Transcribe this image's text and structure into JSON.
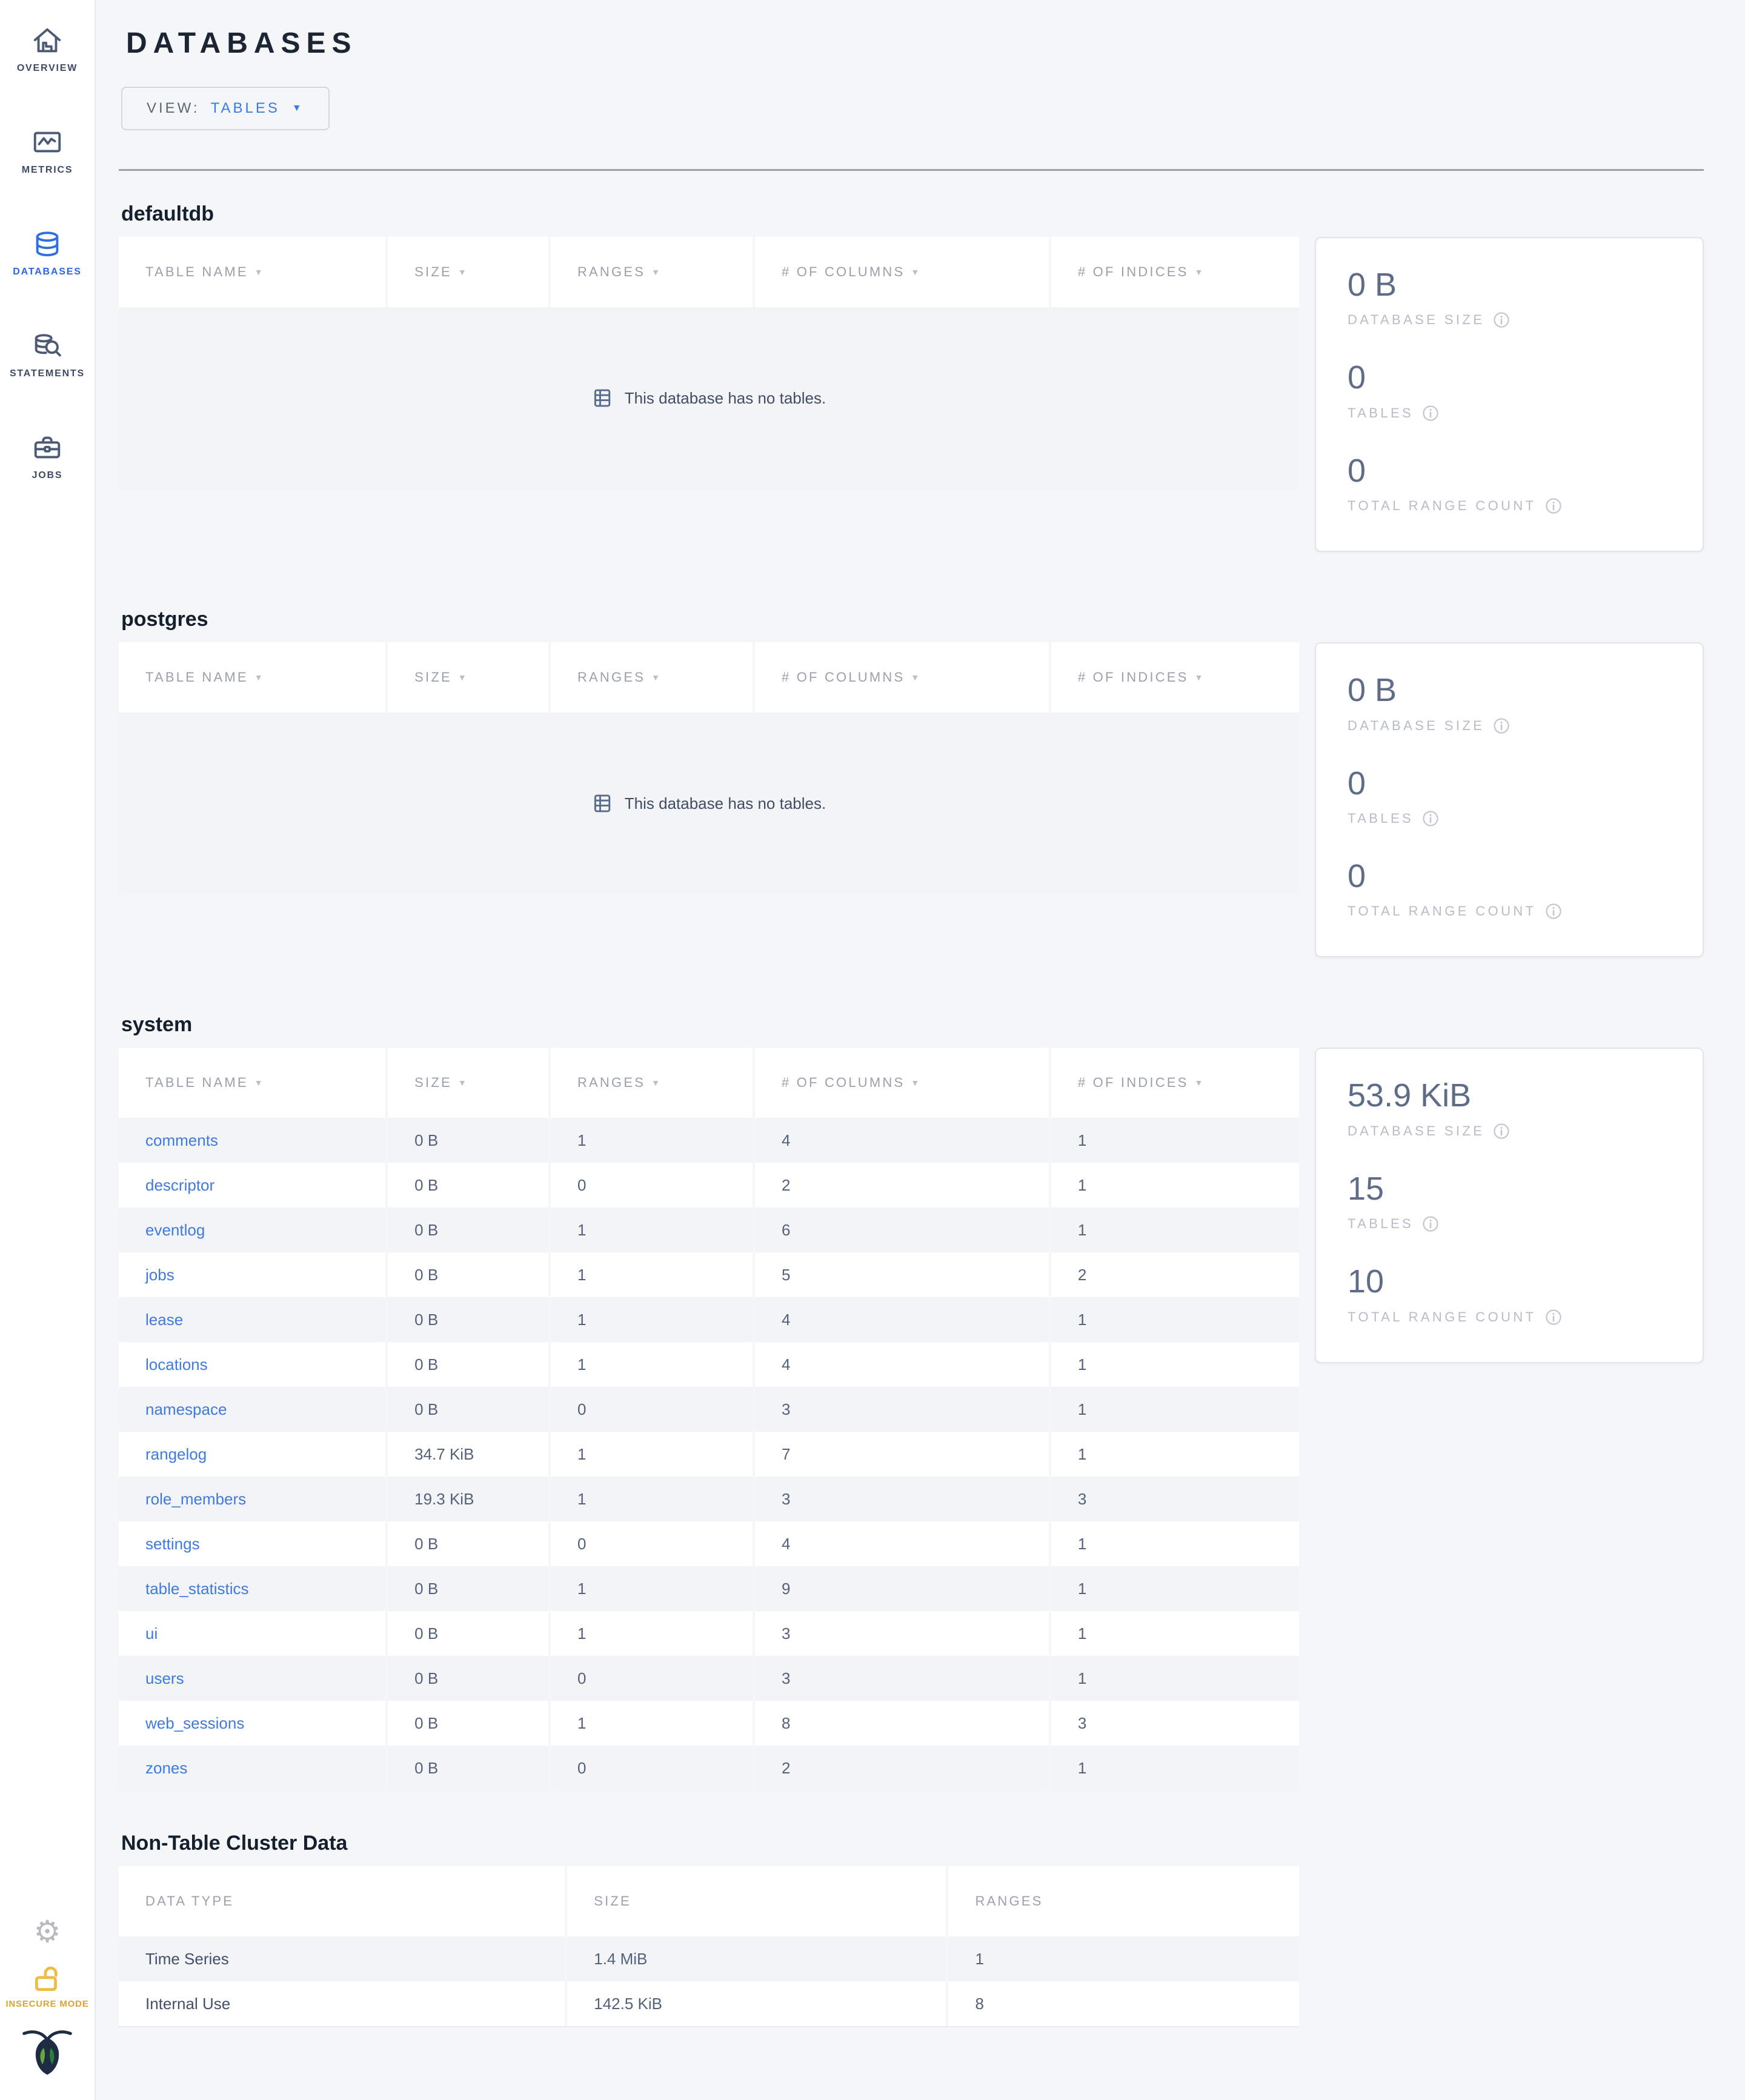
{
  "sidebar": {
    "items": [
      {
        "label": "OVERVIEW",
        "icon": "home-icon",
        "active": false
      },
      {
        "label": "METRICS",
        "icon": "metrics-icon",
        "active": false
      },
      {
        "label": "DATABASES",
        "icon": "database-icon",
        "active": true
      },
      {
        "label": "STATEMENTS",
        "icon": "statements-icon",
        "active": false
      },
      {
        "label": "JOBS",
        "icon": "jobs-icon",
        "active": false
      }
    ],
    "insecure_label": "INSECURE MODE"
  },
  "header": {
    "title": "DATABASES",
    "view_label": "VIEW:",
    "view_value": "TABLES"
  },
  "table_headers": {
    "name": "TABLE NAME",
    "size": "SIZE",
    "ranges": "RANGES",
    "columns": "# OF COLUMNS",
    "indices": "# OF INDICES"
  },
  "empty_message": "This database has no tables.",
  "stat_labels": {
    "size": "DATABASE SIZE",
    "tables": "TABLES",
    "range_count": "TOTAL RANGE COUNT"
  },
  "databases": [
    {
      "name": "defaultdb",
      "stats": {
        "size": "0 B",
        "tables": "0",
        "range_count": "0"
      },
      "tables": []
    },
    {
      "name": "postgres",
      "stats": {
        "size": "0 B",
        "tables": "0",
        "range_count": "0"
      },
      "tables": []
    },
    {
      "name": "system",
      "stats": {
        "size": "53.9 KiB",
        "tables": "15",
        "range_count": "10"
      },
      "tables": [
        {
          "name": "comments",
          "size": "0 B",
          "ranges": "1",
          "columns": "4",
          "indices": "1"
        },
        {
          "name": "descriptor",
          "size": "0 B",
          "ranges": "0",
          "columns": "2",
          "indices": "1"
        },
        {
          "name": "eventlog",
          "size": "0 B",
          "ranges": "1",
          "columns": "6",
          "indices": "1"
        },
        {
          "name": "jobs",
          "size": "0 B",
          "ranges": "1",
          "columns": "5",
          "indices": "2"
        },
        {
          "name": "lease",
          "size": "0 B",
          "ranges": "1",
          "columns": "4",
          "indices": "1"
        },
        {
          "name": "locations",
          "size": "0 B",
          "ranges": "1",
          "columns": "4",
          "indices": "1"
        },
        {
          "name": "namespace",
          "size": "0 B",
          "ranges": "0",
          "columns": "3",
          "indices": "1"
        },
        {
          "name": "rangelog",
          "size": "34.7 KiB",
          "ranges": "1",
          "columns": "7",
          "indices": "1"
        },
        {
          "name": "role_members",
          "size": "19.3 KiB",
          "ranges": "1",
          "columns": "3",
          "indices": "3"
        },
        {
          "name": "settings",
          "size": "0 B",
          "ranges": "0",
          "columns": "4",
          "indices": "1"
        },
        {
          "name": "table_statistics",
          "size": "0 B",
          "ranges": "1",
          "columns": "9",
          "indices": "1"
        },
        {
          "name": "ui",
          "size": "0 B",
          "ranges": "1",
          "columns": "3",
          "indices": "1"
        },
        {
          "name": "users",
          "size": "0 B",
          "ranges": "0",
          "columns": "3",
          "indices": "1"
        },
        {
          "name": "web_sessions",
          "size": "0 B",
          "ranges": "1",
          "columns": "8",
          "indices": "3"
        },
        {
          "name": "zones",
          "size": "0 B",
          "ranges": "0",
          "columns": "2",
          "indices": "1"
        }
      ]
    }
  ],
  "non_table": {
    "title": "Non-Table Cluster Data",
    "headers": [
      "DATA TYPE",
      "SIZE",
      "RANGES"
    ],
    "rows": [
      {
        "type": "Time Series",
        "size": "1.4 MiB",
        "ranges": "1"
      },
      {
        "type": "Internal Use",
        "size": "142.5 KiB",
        "ranges": "8"
      }
    ]
  },
  "colors": {
    "link_blue": "#3f7ae0",
    "active_nav_blue": "#2a66e0",
    "insecure_gold": "#dfa42d",
    "stat_slate": "#5f6c87",
    "page_background": "#f5f6f8"
  }
}
